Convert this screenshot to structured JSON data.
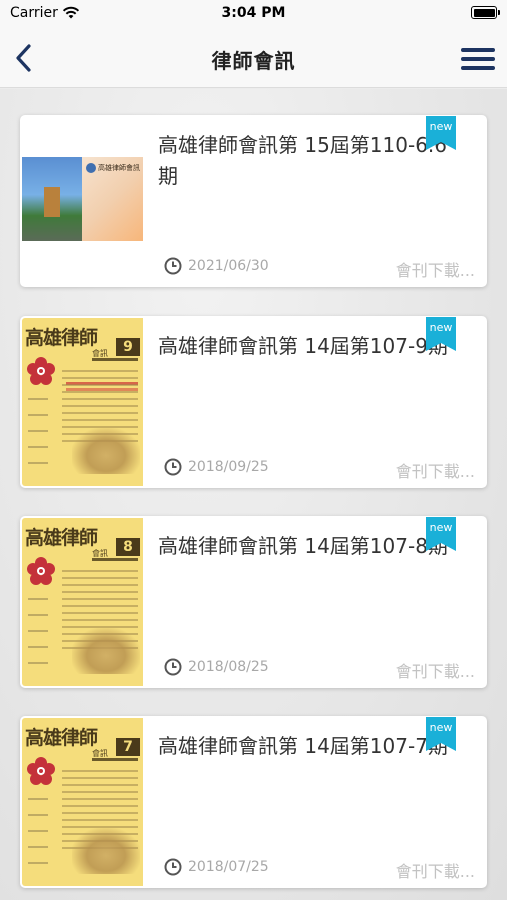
{
  "status_bar": {
    "carrier": "Carrier",
    "time": "3:04 PM"
  },
  "nav": {
    "title": "律師會訊",
    "back_icon": "chevron-left-icon",
    "menu_icon": "hamburger-menu-icon"
  },
  "colors": {
    "accent": "#1d3461",
    "badge": "#1ab0d8",
    "muted_text": "#a8a8a8"
  },
  "issues": [
    {
      "title": "高雄律師會訊第 15屆第110-6.6期",
      "badge": "new",
      "date": "2021/06/30",
      "download": "會刊下載...",
      "cover_number": ""
    },
    {
      "title": "高雄律師會訊第 14屆第107-9期",
      "badge": "new",
      "date": "2018/09/25",
      "download": "會刊下載...",
      "cover_number": "9"
    },
    {
      "title": "高雄律師會訊第 14屆第107-8期",
      "badge": "new",
      "date": "2018/08/25",
      "download": "會刊下載...",
      "cover_number": "8"
    },
    {
      "title": "高雄律師會訊第 14屆第107-7期",
      "badge": "new",
      "date": "2018/07/25",
      "download": "會刊下載...",
      "cover_number": "7"
    }
  ],
  "cover_text": {
    "calligraphy": "高雄律師",
    "meeting": "會訊",
    "journal_title": "高雄律師會訊"
  }
}
